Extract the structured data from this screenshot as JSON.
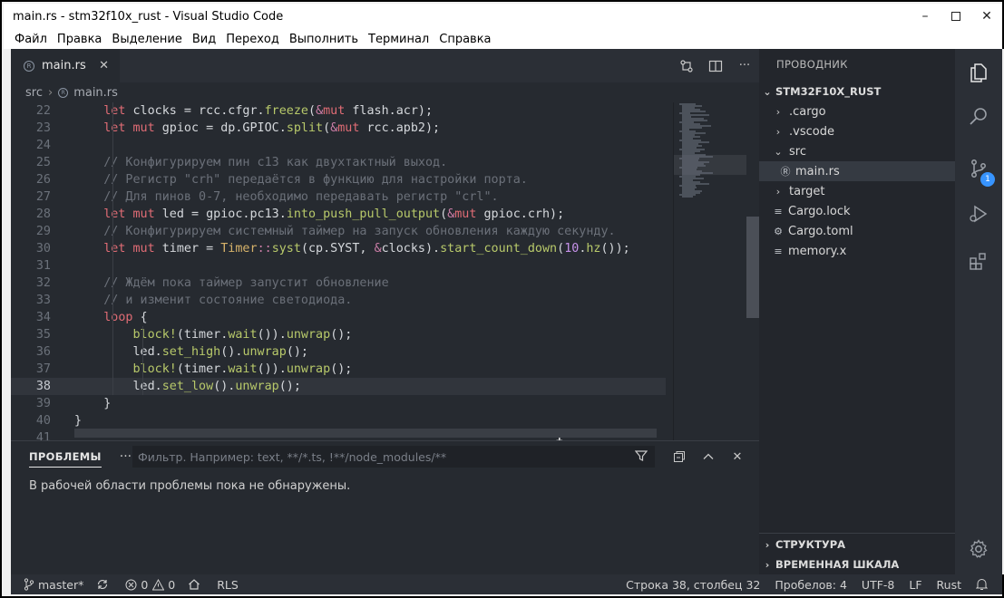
{
  "window": {
    "title": "main.rs - stm32f10x_rust - Visual Studio Code"
  },
  "menu": [
    "Файл",
    "Правка",
    "Выделение",
    "Вид",
    "Переход",
    "Выполнить",
    "Терминал",
    "Справка"
  ],
  "tab": {
    "label": "main.rs"
  },
  "breadcrumb": {
    "folder": "src",
    "file": "main.rs"
  },
  "code_lines": [
    {
      "n": "22",
      "t": "    let clocks = rcc.cfgr.freeze(&mut flash.acr);"
    },
    {
      "n": "23",
      "t": "    let mut gpioc = dp.GPIOC.split(&mut rcc.apb2);"
    },
    {
      "n": "24",
      "t": ""
    },
    {
      "n": "25",
      "t": "    // Конфигурируем пин c13 как двухтактный выход."
    },
    {
      "n": "26",
      "t": "    // Регистр \"crh\" передаётся в функцию для настройки порта."
    },
    {
      "n": "27",
      "t": "    // Для пинов 0-7, необходимо передавать регистр \"crl\"."
    },
    {
      "n": "28",
      "t": "    let mut led = gpioc.pc13.into_push_pull_output(&mut gpioc.crh);"
    },
    {
      "n": "29",
      "t": "    // Конфигурируем системный таймер на запуск обновления каждую секунду."
    },
    {
      "n": "30",
      "t": "    let mut timer = Timer::syst(cp.SYST, &clocks).start_count_down(10.hz());"
    },
    {
      "n": "31",
      "t": ""
    },
    {
      "n": "32",
      "t": "    // Ждём пока таймер запустит обновление"
    },
    {
      "n": "33",
      "t": "    // и изменит состояние светодиода."
    },
    {
      "n": "34",
      "t": "    loop {"
    },
    {
      "n": "35",
      "t": "        block!(timer.wait()).unwrap();"
    },
    {
      "n": "36",
      "t": "        led.set_high().unwrap();"
    },
    {
      "n": "37",
      "t": "        block!(timer.wait()).unwrap();"
    },
    {
      "n": "38",
      "t": "        led.set_low().unwrap();"
    },
    {
      "n": "39",
      "t": "    }"
    },
    {
      "n": "40",
      "t": "}"
    },
    {
      "n": "41",
      "t": ""
    }
  ],
  "panel": {
    "title": "ПРОБЛЕМЫ",
    "filter_placeholder": "Фильтр. Например: text, **/*.ts, !**/node_modules/**",
    "message": "В рабочей области проблемы пока не обнаружены."
  },
  "explorer": {
    "title": "ПРОВОДНИК",
    "root": "STM32F10X_RUST",
    "items": [
      {
        "label": ".cargo",
        "kind": "folder",
        "expanded": false
      },
      {
        "label": ".vscode",
        "kind": "folder",
        "expanded": false
      },
      {
        "label": "src",
        "kind": "folder",
        "expanded": true
      },
      {
        "label": "main.rs",
        "kind": "rust-file",
        "selected": true
      },
      {
        "label": "target",
        "kind": "folder",
        "expanded": false
      },
      {
        "label": "Cargo.lock",
        "kind": "file"
      },
      {
        "label": "Cargo.toml",
        "kind": "gear-file"
      },
      {
        "label": "memory.x",
        "kind": "file"
      }
    ],
    "outline": "СТРУКТУРА",
    "timeline": "ВРЕМЕННАЯ ШКАЛА"
  },
  "activity": {
    "scm_badge": "1"
  },
  "status": {
    "branch": "master*",
    "errors": "0",
    "warnings": "0",
    "rls": "RLS",
    "position": "Строка 38, столбец 32",
    "spaces": "Пробелов: 4",
    "encoding": "UTF-8",
    "eol": "LF",
    "language": "Rust"
  },
  "colors": {
    "editor_bg": "#262a30",
    "keyword": "#e06c75",
    "function": "#b8c96a",
    "comment": "#6b7079",
    "badge": "#3794ff"
  }
}
